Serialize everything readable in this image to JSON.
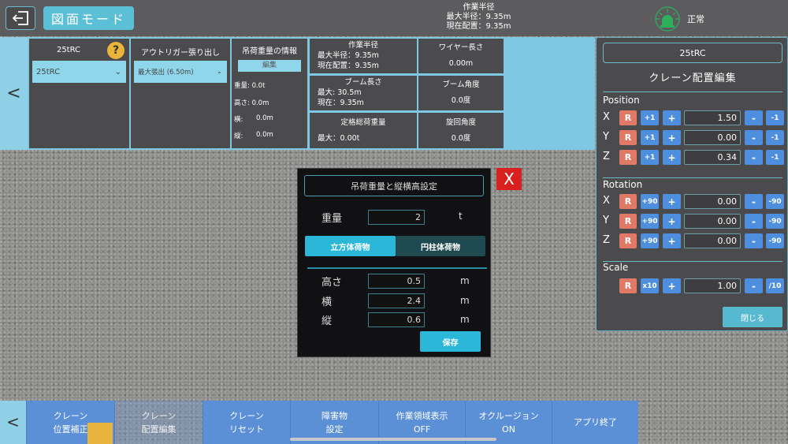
{
  "header": {
    "back_icon": "exit-icon",
    "mode_label": "図面モード",
    "radius": {
      "title": "作業半径",
      "max": "最大半径：9.35m",
      "current": "現在配置：9.35m"
    },
    "status": {
      "icon": "beacon-light-icon",
      "label": "正常",
      "color": "#2fae5c"
    }
  },
  "top_panel": {
    "collapse": "<",
    "crane": {
      "title": "25tRC",
      "help": "?",
      "selected": "25tRC"
    },
    "outrigger": {
      "title": "アウトリガー張り出し",
      "selected": "最大張出 (6.50m)"
    },
    "load": {
      "title": "吊荷重量の情報",
      "edit": "編集",
      "weight": "重量: 0.0t",
      "height": "高さ: 0.0m",
      "width_label": "横:",
      "width_value": "0.0m",
      "depth_label": "縦:",
      "depth_value": "0.0m"
    },
    "grid": {
      "radius": {
        "title": "作業半径",
        "max": "最大半径：9.35m",
        "current": "現在配置：9.35m"
      },
      "wire": {
        "title": "ワイヤー長さ",
        "value": "0.00m"
      },
      "boom_length": {
        "title": "ブーム長さ",
        "max": "最大: 30.5m",
        "current": "現在：9.35m"
      },
      "boom_angle": {
        "title": "ブーム角度",
        "value": "0.0度"
      },
      "rated_load": {
        "title": "定格総荷重量",
        "max": "最大：0.00t"
      },
      "swing_angle": {
        "title": "旋回角度",
        "value": "0.0度"
      }
    }
  },
  "editor": {
    "crane_name": "25tRC",
    "heading": "クレーン配置編集",
    "position": {
      "label": "Position",
      "rows": [
        {
          "axis": "X",
          "value": "1.50"
        },
        {
          "axis": "Y",
          "value": "0.00"
        },
        {
          "axis": "Z",
          "value": "0.34"
        }
      ],
      "reset": "R",
      "inc": "+1",
      "plus": "+",
      "minus": "-",
      "dec": "-1"
    },
    "rotation": {
      "label": "Rotation",
      "rows": [
        {
          "axis": "X",
          "value": "0.00"
        },
        {
          "axis": "Y",
          "value": "0.00"
        },
        {
          "axis": "Z",
          "value": "0.00"
        }
      ],
      "reset": "R",
      "inc": "+90",
      "plus": "+",
      "minus": "-",
      "dec": "-90"
    },
    "scale": {
      "label": "Scale",
      "value": "1.00",
      "reset": "R",
      "inc": "x10",
      "plus": "+",
      "minus": "-",
      "dec": "/10"
    },
    "close": "閉じる"
  },
  "dialog": {
    "title": "吊荷重量と縦横高設定",
    "close": "X",
    "weight_label": "重量",
    "weight": "2",
    "weight_unit": "t",
    "tabs": [
      "立方体荷物",
      "円柱体荷物"
    ],
    "height_label": "高さ",
    "height": "0.5",
    "width_label": "横",
    "width": "2.4",
    "depth_label": "縦",
    "depth": "0.6",
    "unit": "m",
    "save": "保存"
  },
  "bottom": {
    "collapse": "<",
    "buttons": [
      {
        "l1": "クレーン",
        "l2": "位置補正"
      },
      {
        "l1": "クレーン",
        "l2": "配置編集"
      },
      {
        "l1": "クレーン",
        "l2": "リセット"
      },
      {
        "l1": "障害物",
        "l2": "設定"
      },
      {
        "l1": "作業領域表示",
        "l2": "OFF"
      },
      {
        "l1": "オクルージョン",
        "l2": "ON"
      },
      {
        "l1": "アプリ終了",
        "l2": ""
      }
    ]
  }
}
